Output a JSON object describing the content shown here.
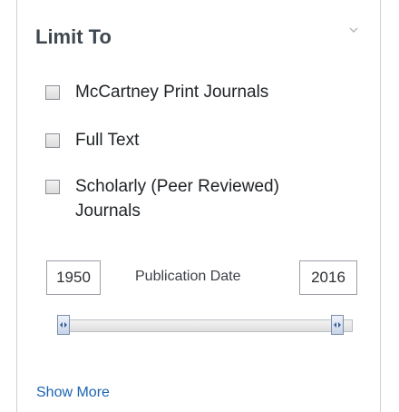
{
  "panel": {
    "title": "Limit To",
    "options": [
      {
        "label": "McCartney Print Journals",
        "checked": false
      },
      {
        "label": "Full Text",
        "checked": false
      },
      {
        "label": "Scholarly (Peer Reviewed) Journals",
        "checked": false
      }
    ],
    "date_range": {
      "label": "Publication Date",
      "from": "1950",
      "to": "2016"
    },
    "show_more_label": "Show More"
  },
  "icons": {
    "collapse": "chevron-down-icon",
    "slider_handle": "slider-handle-icon"
  },
  "colors": {
    "link": "#1a64b0",
    "title": "#3f4750",
    "border": "#c9d1d9"
  }
}
